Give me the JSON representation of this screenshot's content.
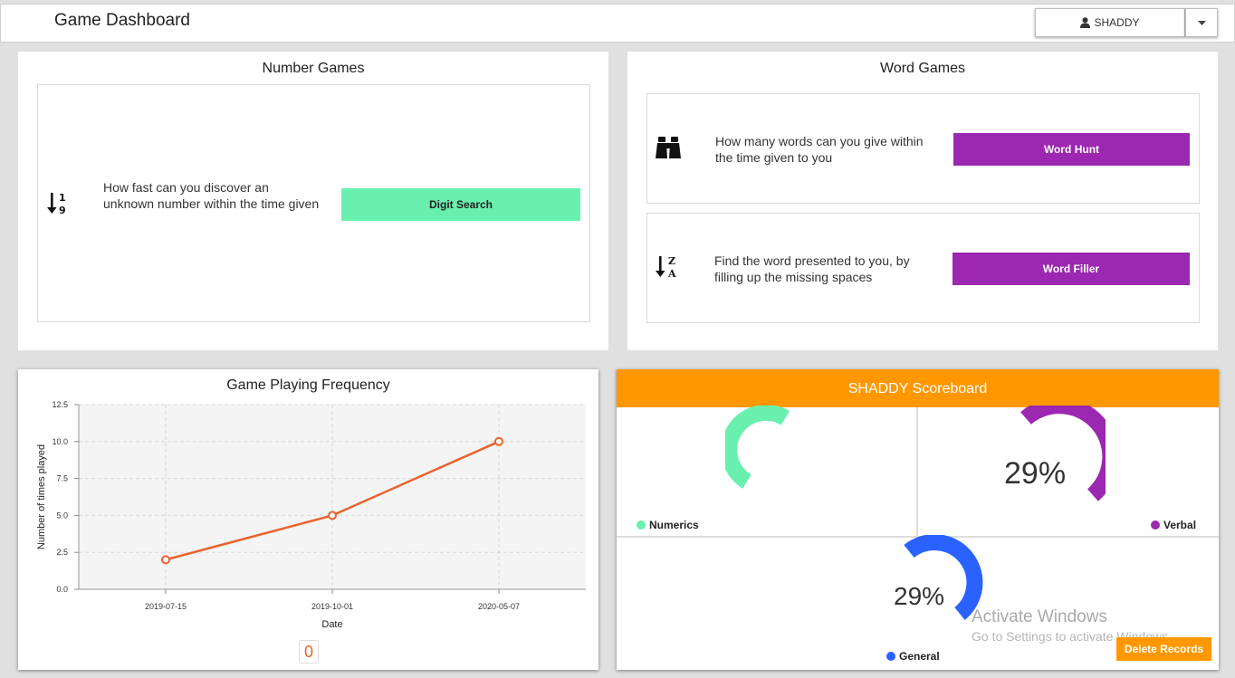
{
  "header": {
    "title": "Game Dashboard",
    "user": "SHADDY"
  },
  "number_games": {
    "title": "Number Games",
    "items": [
      {
        "description": "How fast can you discover an unknown number within the time given",
        "button": "Digit Search",
        "icon": "sort-numeric-icon",
        "color": "#69f0ae"
      }
    ]
  },
  "word_games": {
    "title": "Word Games",
    "items": [
      {
        "description": "How many words can you give within the time given to you",
        "button": "Word Hunt",
        "icon": "binoculars-icon",
        "color": "#9c27b0"
      },
      {
        "description": "Find the word presented to you, by filling up the missing spaces",
        "button": "Word Filler",
        "icon": "sort-alpha-desc-icon",
        "color": "#9c27b0"
      }
    ]
  },
  "frequency": {
    "title": "Game Playing Frequency",
    "counter": "0",
    "chart_data": {
      "type": "line",
      "x": [
        "2019-07-15",
        "2019-10-01",
        "2020-05-07"
      ],
      "values": [
        2,
        5,
        10
      ],
      "xlabel": "Date",
      "ylabel": "Number of times played",
      "ylim": [
        0,
        12.5
      ],
      "yticks": [
        "0.0",
        "2.5",
        "5.0",
        "7.5",
        "10.0",
        "12.5"
      ],
      "grid": true,
      "color": "#e8622f"
    }
  },
  "scoreboard": {
    "title": "SHADDY Scoreboard",
    "header_color": "#ff9800",
    "gauges": [
      {
        "label": "Numerics",
        "percent_text": "",
        "color": "#69f0ae"
      },
      {
        "label": "Verbal",
        "percent_text": "29%",
        "color": "#9c27b0"
      },
      {
        "label": "General",
        "percent_text": "29%",
        "color": "#2962ff"
      }
    ],
    "delete_button": "Delete Records"
  },
  "watermark": {
    "line1": "Activate Windows",
    "line2": "Go to Settings to activate Windows."
  }
}
